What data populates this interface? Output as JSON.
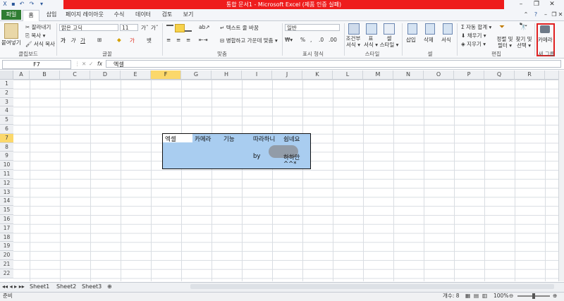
{
  "window": {
    "title": "통합 문서1 - Microsoft Excel (제품 인증 실패)",
    "min_icon": "minimize-icon",
    "restore_icon": "restore-icon",
    "close_icon": "close-icon"
  },
  "tabs": {
    "file": "파일",
    "home": "홈",
    "insert": "삽입",
    "page_layout": "페이지 레이아웃",
    "formulas": "수식",
    "data": "데이터",
    "review": "검토",
    "view": "보기"
  },
  "ribbon": {
    "clipboard": {
      "paste": "붙여넣기",
      "cut": "잘라내기",
      "copy": "복사",
      "format_painter": "서식 복사",
      "group": "클립보드"
    },
    "font": {
      "name": "맑은 고딕",
      "size": "11",
      "group": "글꼴"
    },
    "alignment": {
      "wrap": "텍스트 줄 바꿈",
      "merge": "병합하고 가운데 맞춤",
      "group": "맞춤"
    },
    "number": {
      "format": "일반",
      "group": "표시 형식"
    },
    "styles": {
      "conditional": "조건부",
      "conditional2": "서식",
      "table": "표",
      "table2": "서식",
      "cell_style": "셀",
      "cell_style2": "스타일",
      "group": "스타일"
    },
    "cells": {
      "insert": "삽입",
      "delete": "삭제",
      "format": "서식",
      "group": "셀"
    },
    "editing": {
      "autosum": "자동 합계",
      "fill": "채우기",
      "clear": "지우기",
      "sort": "정렬 및",
      "sort2": "필터",
      "find": "찾기 및",
      "find2": "선택",
      "group": "편집"
    },
    "new_group": {
      "camera": "카메라",
      "group": "새 그룹"
    }
  },
  "formula_bar": {
    "name_box": "F7",
    "fx": "fx",
    "content": "엑셀"
  },
  "grid": {
    "columns": [
      "A",
      "B",
      "C",
      "D",
      "E",
      "F",
      "G",
      "H",
      "I",
      "J",
      "K",
      "L",
      "M",
      "N",
      "O",
      "P",
      "Q",
      "R"
    ],
    "rows": [
      "1",
      "2",
      "3",
      "4",
      "5",
      "6",
      "7",
      "8",
      "9",
      "10",
      "11",
      "12",
      "13",
      "14",
      "15",
      "16",
      "17",
      "18",
      "19",
      "20",
      "21",
      "22"
    ]
  },
  "camera_picture": {
    "row1": [
      "엑셀",
      "카메라",
      "기능",
      "따라하니",
      "쉽네요"
    ],
    "by": "by",
    "author": "하하만",
    "smile": "^^*"
  },
  "sheets": [
    "Sheet1",
    "Sheet2",
    "Sheet3"
  ],
  "status": {
    "ready": "준비",
    "count": "개수: 8",
    "zoom": "100%"
  }
}
